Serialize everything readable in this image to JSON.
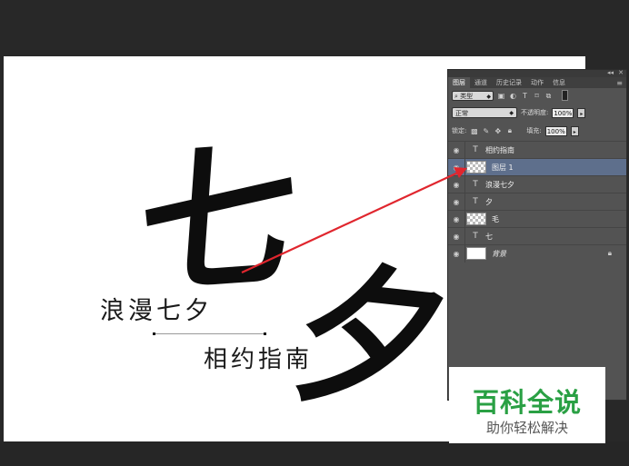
{
  "canvas": {
    "big_char_1": "七",
    "big_char_2": "夕",
    "text_romance": "浪漫七夕",
    "text_guide": "相约指南"
  },
  "panel": {
    "tabs": [
      "图层",
      "通道",
      "历史记录",
      "动作",
      "信息"
    ],
    "filter_type": "类型",
    "blend_mode": "正常",
    "opacity_label": "不透明度:",
    "opacity_value": "100%",
    "lock_label": "锁定:",
    "fill_label": "填充:",
    "fill_value": "100%",
    "layers": [
      {
        "name": "相约指南",
        "kind": "text"
      },
      {
        "name": "图层 1",
        "kind": "pixel",
        "selected": true
      },
      {
        "name": "浪漫七夕",
        "kind": "text"
      },
      {
        "name": "夕",
        "kind": "text"
      },
      {
        "name": "毛",
        "kind": "pixel"
      },
      {
        "name": "七",
        "kind": "text"
      },
      {
        "name": "背景",
        "kind": "background",
        "locked": true
      }
    ]
  },
  "watermark": {
    "title": "百科全说",
    "subtitle": "助你轻松解决"
  },
  "colors": {
    "workspace": "#282828",
    "panel": "#535353",
    "selected_layer": "#5e6f8c",
    "arrow": "#e0262e",
    "watermark_green": "#2aa044"
  }
}
